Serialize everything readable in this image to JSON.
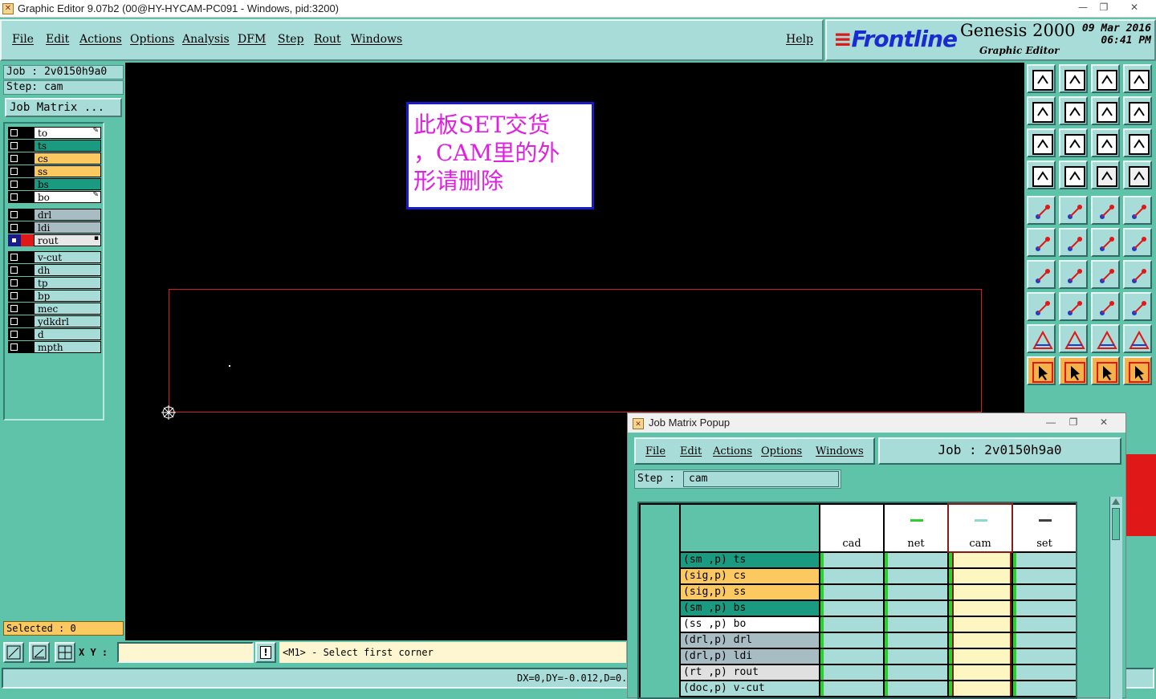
{
  "window": {
    "title": "Graphic Editor 9.07b2 (00@HY-HYCAM-PC091 - Windows, pid:3200)",
    "min_glyph": "—",
    "max_glyph": "❐",
    "close_glyph": "✕"
  },
  "menu": {
    "items": [
      "File",
      "Edit",
      "Actions",
      "Options",
      "Analysis",
      "DFM",
      "Step",
      "Rout",
      "Windows"
    ],
    "help": "Help"
  },
  "brand": {
    "logo": "Frontline",
    "product": "Genesis 2000",
    "subtitle": "Graphic Editor",
    "date": "09 Mar 2016",
    "time": "06:41 PM"
  },
  "left": {
    "job": "Job : 2v0150h9a0",
    "step": "Step: cam",
    "job_matrix_button": "Job Matrix ...",
    "selected": "Selected : 0",
    "layers": [
      {
        "name": "to",
        "color": "#ffffff",
        "mark": "✎"
      },
      {
        "name": "ts",
        "color": "#1a9a80",
        "mark": ""
      },
      {
        "name": "cs",
        "color": "#fcc860",
        "mark": ""
      },
      {
        "name": "ss",
        "color": "#fcc860",
        "mark": ""
      },
      {
        "name": "bs",
        "color": "#1a9a80",
        "mark": ""
      },
      {
        "name": "bo",
        "color": "#ffffff",
        "mark": "✎"
      },
      {
        "name": "drl",
        "color": "#a8bcc4",
        "mark": ""
      },
      {
        "name": "ldi",
        "color": "#a8bcc4",
        "mark": ""
      },
      {
        "name": "rout",
        "color": "#e8e8e8",
        "mark": "▪"
      },
      {
        "name": "v-cut",
        "color": "#a8dcd8",
        "mark": ""
      },
      {
        "name": "dh",
        "color": "#a8dcd8",
        "mark": ""
      },
      {
        "name": "tp",
        "color": "#a8dcd8",
        "mark": ""
      },
      {
        "name": "bp",
        "color": "#a8dcd8",
        "mark": ""
      },
      {
        "name": "mec",
        "color": "#a8dcd8",
        "mark": ""
      },
      {
        "name": "ydkdrl",
        "color": "#a8dcd8",
        "mark": ""
      },
      {
        "name": "d",
        "color": "#a8dcd8",
        "mark": ""
      },
      {
        "name": "mpth",
        "color": "#a8dcd8",
        "mark": ""
      }
    ]
  },
  "canvas": {
    "note_line1": "此板SET交货",
    "note_line2": "，CAM里的外",
    "note_line3": "形请删除"
  },
  "bottom": {
    "xy_label": "X Y :",
    "xy_value": "",
    "warn_glyph": "!",
    "prompt": "<M1> - Select first corner",
    "status": "DX=0,DY=-0.012,D=0.0"
  },
  "popup": {
    "title": "Job Matrix Popup",
    "menu": [
      "File",
      "Edit",
      "Actions",
      "Options",
      "Windows"
    ],
    "job": "Job : 2v0150h9a0",
    "step_label": "Step :",
    "step_value": "cam",
    "columns": [
      "cad",
      "net",
      "cam",
      "set"
    ],
    "rows": [
      {
        "label": "(sm ,p) ts",
        "color": "#1a9a80"
      },
      {
        "label": "(sig,p) cs",
        "color": "#fcc860"
      },
      {
        "label": "(sig,p) ss",
        "color": "#fcc860"
      },
      {
        "label": "(sm ,p) bs",
        "color": "#1a9a80"
      },
      {
        "label": "(ss ,p) bo",
        "color": "#ffffff"
      },
      {
        "label": "(drl,p) drl",
        "color": "#a8bcc4"
      },
      {
        "label": "(drl,p) ldi",
        "color": "#a8bcc4"
      },
      {
        "label": "(rt ,p) rout",
        "color": "#e0e0e0"
      },
      {
        "label": "(doc,p) v-cut",
        "color": "#a8dcd8"
      }
    ]
  }
}
